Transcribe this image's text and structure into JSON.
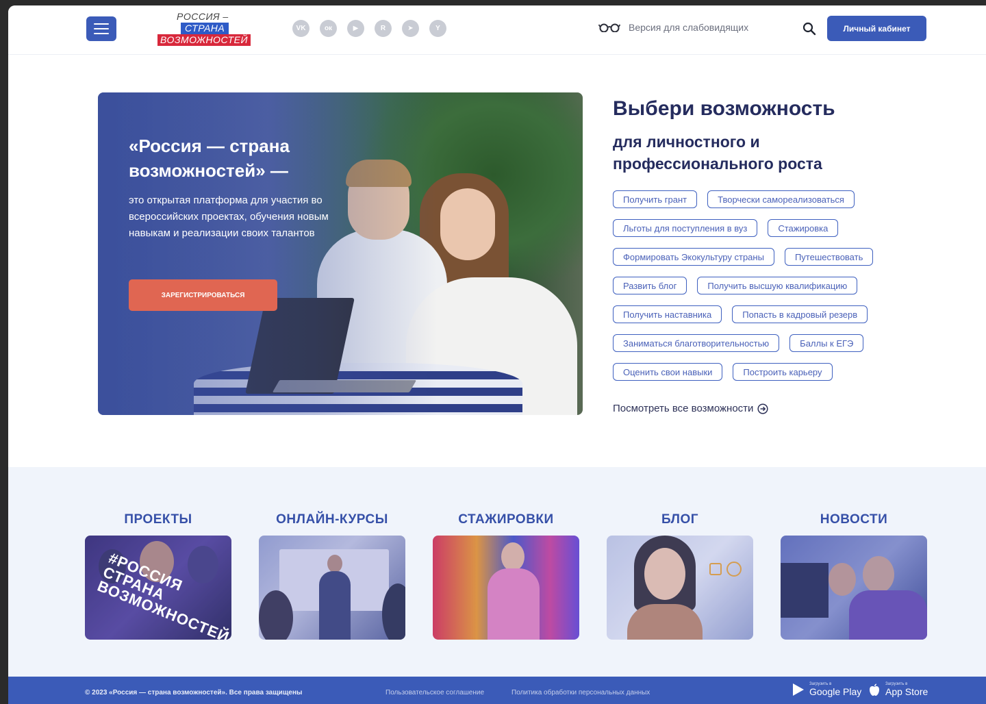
{
  "header": {
    "logo": {
      "line1": "РОССИЯ –",
      "line2": "СТРАНА",
      "line3": "ВОЗМОЖНОСТЕЙ"
    },
    "socials": [
      {
        "icon": "vk-icon",
        "glyph": "VK"
      },
      {
        "icon": "ok-icon",
        "glyph": "ок"
      },
      {
        "icon": "youtube-icon",
        "glyph": "▶"
      },
      {
        "icon": "rutube-icon",
        "glyph": "R"
      },
      {
        "icon": "telegram-icon",
        "glyph": "➤"
      },
      {
        "icon": "yandex-icon",
        "glyph": "Y"
      }
    ],
    "vision_label": "Версия для слабовидящих",
    "cabinet_label": "Личный кабинет"
  },
  "hero": {
    "title": "«Россия — страна возможностей» —",
    "description": "это открытая платформа для участия во всероссийских проектах, обучения новым навыкам и реализации своих талантов",
    "register_label": "ЗАРЕГИСТРИРОВАТЬСЯ"
  },
  "opportunities": {
    "title": "Выбери возможность",
    "subtitle": "для личностного и профессионального роста",
    "tags": [
      "Получить грант",
      "Творчески самореализоваться",
      "Льготы для поступления в вуз",
      "Стажировка",
      "Формировать Экокультуру страны",
      "Путешествовать",
      "Развить блог",
      "Получить высшую квалификацию",
      "Получить наставника",
      "Попасть в кадровый резерв",
      "Заниматься благотворительностью",
      "Баллы к ЕГЭ",
      "Оценить свои навыки",
      "Построить карьеру"
    ],
    "see_all": "Посмотреть все возможности"
  },
  "categories": [
    {
      "title": "ПРОЕКТЫ",
      "image_text": "#РОССИЯ СТРАНА ВОЗМОЖНОСТЕЙ"
    },
    {
      "title": "ОНЛАЙН-КУРСЫ"
    },
    {
      "title": "СТАЖИРОВКИ"
    },
    {
      "title": "БЛОГ"
    },
    {
      "title": "НОВОСТИ"
    }
  ],
  "footer": {
    "copyright": "© 2023 «Россия — страна возможностей». Все права защищены",
    "links": [
      "Пользовательское соглашение",
      "Политика обработки персональных данных"
    ],
    "google_play": {
      "small": "Загрузить в",
      "big": "Google Play"
    },
    "app_store": {
      "small": "Загрузить в",
      "big": "App Store"
    }
  },
  "colors": {
    "primary": "#3b5bb8",
    "accent_button": "#e06652",
    "heading": "#252c5e",
    "section_bg": "#f0f4fb"
  }
}
